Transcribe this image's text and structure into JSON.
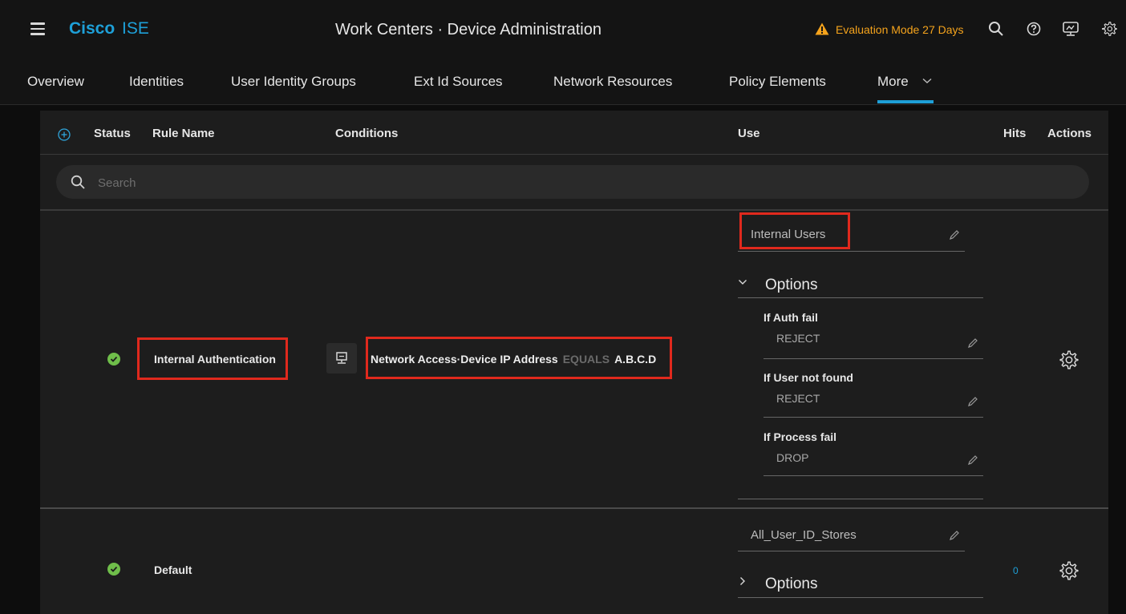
{
  "topbar": {
    "brand_cisco": "Cisco",
    "brand_product": "ISE",
    "title": "Work Centers · Device Administration",
    "evaluation": "Evaluation Mode 27 Days",
    "icons": [
      "hamburger-menu-icon",
      "warning-icon",
      "search-icon",
      "help-icon",
      "monitor-icon",
      "gear-icon"
    ],
    "brand_color": "#1ea0d8",
    "warning_color": "#f5a31c"
  },
  "tabs": [
    {
      "label": "Overview"
    },
    {
      "label": "Identities"
    },
    {
      "label": "User Identity Groups"
    },
    {
      "label": "Ext Id Sources"
    },
    {
      "label": "Network Resources"
    },
    {
      "label": "Policy Elements"
    },
    {
      "label": "More",
      "active": true
    }
  ],
  "table": {
    "headers": {
      "status": "Status",
      "rule_name": "Rule Name",
      "conditions": "Conditions",
      "use": "Use",
      "hits": "Hits",
      "actions": "Actions"
    },
    "search_placeholder": "Search"
  },
  "rules": [
    {
      "status": "enabled",
      "name": "Internal Authentication",
      "condition": {
        "attribute": "Network Access·Device IP Address",
        "operator": "EQUALS",
        "value": "A.B.C.D"
      },
      "use": "Internal Users",
      "options_label": "Options",
      "options_expanded": true,
      "options": [
        {
          "label": "If Auth fail",
          "value": "REJECT"
        },
        {
          "label": "If User not found",
          "value": "REJECT"
        },
        {
          "label": "If Process fail",
          "value": "DROP"
        }
      ],
      "hits": ""
    },
    {
      "status": "enabled",
      "name": "Default",
      "use": "All_User_ID_Stores",
      "options_label": "Options",
      "options_expanded": false,
      "hits": "0"
    }
  ],
  "colors": {
    "status_enabled": "#6fbe4a",
    "highlight_box": "#e0291d",
    "active_tab_underline": "#1ea0d8"
  }
}
